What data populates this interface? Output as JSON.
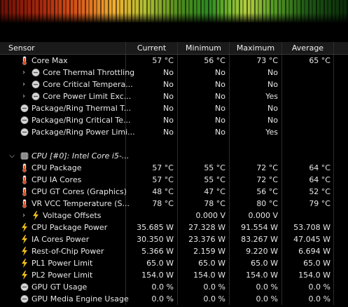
{
  "header": {
    "sensor": "Sensor",
    "current": "Current",
    "minimum": "Minimum",
    "maximum": "Maximum",
    "average": "Average"
  },
  "rows": [
    {
      "label": "Core Max",
      "icon": "thermometer-icon",
      "indent": 1,
      "expander": "",
      "cur": "57 °C",
      "min": "56 °C",
      "max": "73 °C",
      "avg": "65 °C"
    },
    {
      "label": "Core Thermal Throttling",
      "icon": "circle-minus-icon",
      "indent": 2,
      "expander": ">",
      "cur": "No",
      "min": "No",
      "max": "No",
      "avg": ""
    },
    {
      "label": "Core Critical Tempera...",
      "icon": "circle-minus-icon",
      "indent": 2,
      "expander": ">",
      "cur": "No",
      "min": "No",
      "max": "No",
      "avg": ""
    },
    {
      "label": "Core Power Limit Exc...",
      "icon": "circle-minus-icon",
      "indent": 2,
      "expander": ">",
      "cur": "No",
      "min": "No",
      "max": "Yes",
      "avg": ""
    },
    {
      "label": "Package/Ring Thermal T...",
      "icon": "circle-minus-icon",
      "indent": 1,
      "expander": "",
      "cur": "No",
      "min": "No",
      "max": "No",
      "avg": ""
    },
    {
      "label": "Package/Ring Critical Te...",
      "icon": "circle-minus-icon",
      "indent": 1,
      "expander": "",
      "cur": "No",
      "min": "No",
      "max": "No",
      "avg": ""
    },
    {
      "label": "Package/Ring Power Limi...",
      "icon": "circle-minus-icon",
      "indent": 1,
      "expander": "",
      "cur": "No",
      "min": "No",
      "max": "Yes",
      "avg": ""
    }
  ],
  "group": {
    "label": "CPU [#0]: Intel Core i5-...",
    "icon": "chip-icon",
    "expander": "v"
  },
  "rows2": [
    {
      "label": "CPU Package",
      "icon": "thermometer-icon",
      "indent": 1,
      "expander": "",
      "cur": "57 °C",
      "min": "55 °C",
      "max": "72 °C",
      "avg": "64 °C"
    },
    {
      "label": "CPU IA Cores",
      "icon": "thermometer-icon",
      "indent": 1,
      "expander": "",
      "cur": "57 °C",
      "min": "55 °C",
      "max": "72 °C",
      "avg": "64 °C"
    },
    {
      "label": "CPU GT Cores (Graphics)",
      "icon": "thermometer-icon",
      "indent": 1,
      "expander": "",
      "cur": "48 °C",
      "min": "47 °C",
      "max": "56 °C",
      "avg": "52 °C"
    },
    {
      "label": "VR VCC Temperature (S...",
      "icon": "thermometer-icon",
      "indent": 1,
      "expander": "",
      "cur": "78 °C",
      "min": "78 °C",
      "max": "80 °C",
      "avg": "79 °C"
    },
    {
      "label": "Voltage Offsets",
      "icon": "bolt-icon",
      "indent": 2,
      "expander": ">",
      "cur": "",
      "min": "0.000 V",
      "max": "0.000 V",
      "avg": ""
    },
    {
      "label": "CPU Package Power",
      "icon": "bolt-icon",
      "indent": 1,
      "expander": "",
      "cur": "35.685 W",
      "min": "27.328 W",
      "max": "91.554 W",
      "avg": "53.708 W"
    },
    {
      "label": "IA Cores Power",
      "icon": "bolt-icon",
      "indent": 1,
      "expander": "",
      "cur": "30.350 W",
      "min": "23.376 W",
      "max": "83.267 W",
      "avg": "47.045 W"
    },
    {
      "label": "Rest-of-Chip Power",
      "icon": "bolt-icon",
      "indent": 1,
      "expander": "",
      "cur": "5.366 W",
      "min": "2.159 W",
      "max": "9.220 W",
      "avg": "6.694 W"
    },
    {
      "label": "PL1 Power Limit",
      "icon": "bolt-icon",
      "indent": 1,
      "expander": "",
      "cur": "65.0 W",
      "min": "65.0 W",
      "max": "65.0 W",
      "avg": "65.0 W"
    },
    {
      "label": "PL2 Power Limit",
      "icon": "bolt-icon",
      "indent": 1,
      "expander": "",
      "cur": "154.0 W",
      "min": "154.0 W",
      "max": "154.0 W",
      "avg": "154.0 W"
    },
    {
      "label": "GPU GT Usage",
      "icon": "circle-minus-icon",
      "indent": 1,
      "expander": "",
      "cur": "0.0 %",
      "min": "0.0 %",
      "max": "0.0 %",
      "avg": "0.0 %"
    },
    {
      "label": "GPU Media Engine Usage",
      "icon": "circle-minus-icon",
      "indent": 1,
      "expander": "",
      "cur": "0.0 %",
      "min": "0.0 %",
      "max": "0.0 %",
      "avg": "0.0 %"
    }
  ],
  "colors": {
    "thermometer_fill": "#e24b1f",
    "bolt": "#f2c21a",
    "circle": "#cfcfcf",
    "text": "#e8e8e8",
    "grid_line": "#2d2d2d"
  }
}
